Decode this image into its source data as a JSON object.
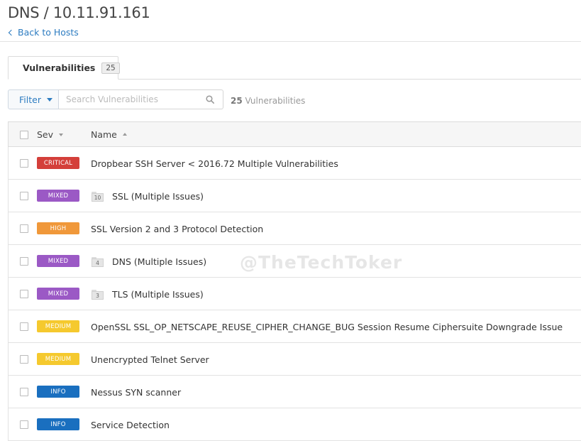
{
  "header": {
    "title": "DNS / 10.11.91.161",
    "back_link": "Back to Hosts"
  },
  "tabs": [
    {
      "label": "Vulnerabilities",
      "count": "25"
    }
  ],
  "toolbar": {
    "filter_label": "Filter",
    "search_placeholder": "Search Vulnerabilities",
    "result_count": "25",
    "result_label": "Vulnerabilities"
  },
  "table": {
    "columns": {
      "sev": "Sev",
      "name": "Name"
    },
    "rows": [
      {
        "severity": "CRITICAL",
        "color": "#d43f3a",
        "folder_count": "",
        "name": "Dropbear SSH Server < 2016.72 Multiple Vulnerabilities"
      },
      {
        "severity": "MIXED",
        "color": "#9b59c5",
        "folder_count": "10",
        "name": "SSL (Multiple Issues)"
      },
      {
        "severity": "HIGH",
        "color": "#f0983a",
        "folder_count": "",
        "name": "SSL Version 2 and 3 Protocol Detection"
      },
      {
        "severity": "MIXED",
        "color": "#9b59c5",
        "folder_count": "4",
        "name": "DNS (Multiple Issues)"
      },
      {
        "severity": "MIXED",
        "color": "#9b59c5",
        "folder_count": "3",
        "name": "TLS (Multiple Issues)"
      },
      {
        "severity": "MEDIUM",
        "color": "#f5c92e",
        "folder_count": "",
        "name": "OpenSSL SSL_OP_NETSCAPE_REUSE_CIPHER_CHANGE_BUG Session Resume Ciphersuite Downgrade Issue"
      },
      {
        "severity": "MEDIUM",
        "color": "#f5c92e",
        "folder_count": "",
        "name": "Unencrypted Telnet Server"
      },
      {
        "severity": "INFO",
        "color": "#1a6fbf",
        "folder_count": "",
        "name": "Nessus SYN scanner"
      },
      {
        "severity": "INFO",
        "color": "#1a6fbf",
        "folder_count": "",
        "name": "Service Detection"
      }
    ]
  },
  "watermark": "@TheTechToker"
}
